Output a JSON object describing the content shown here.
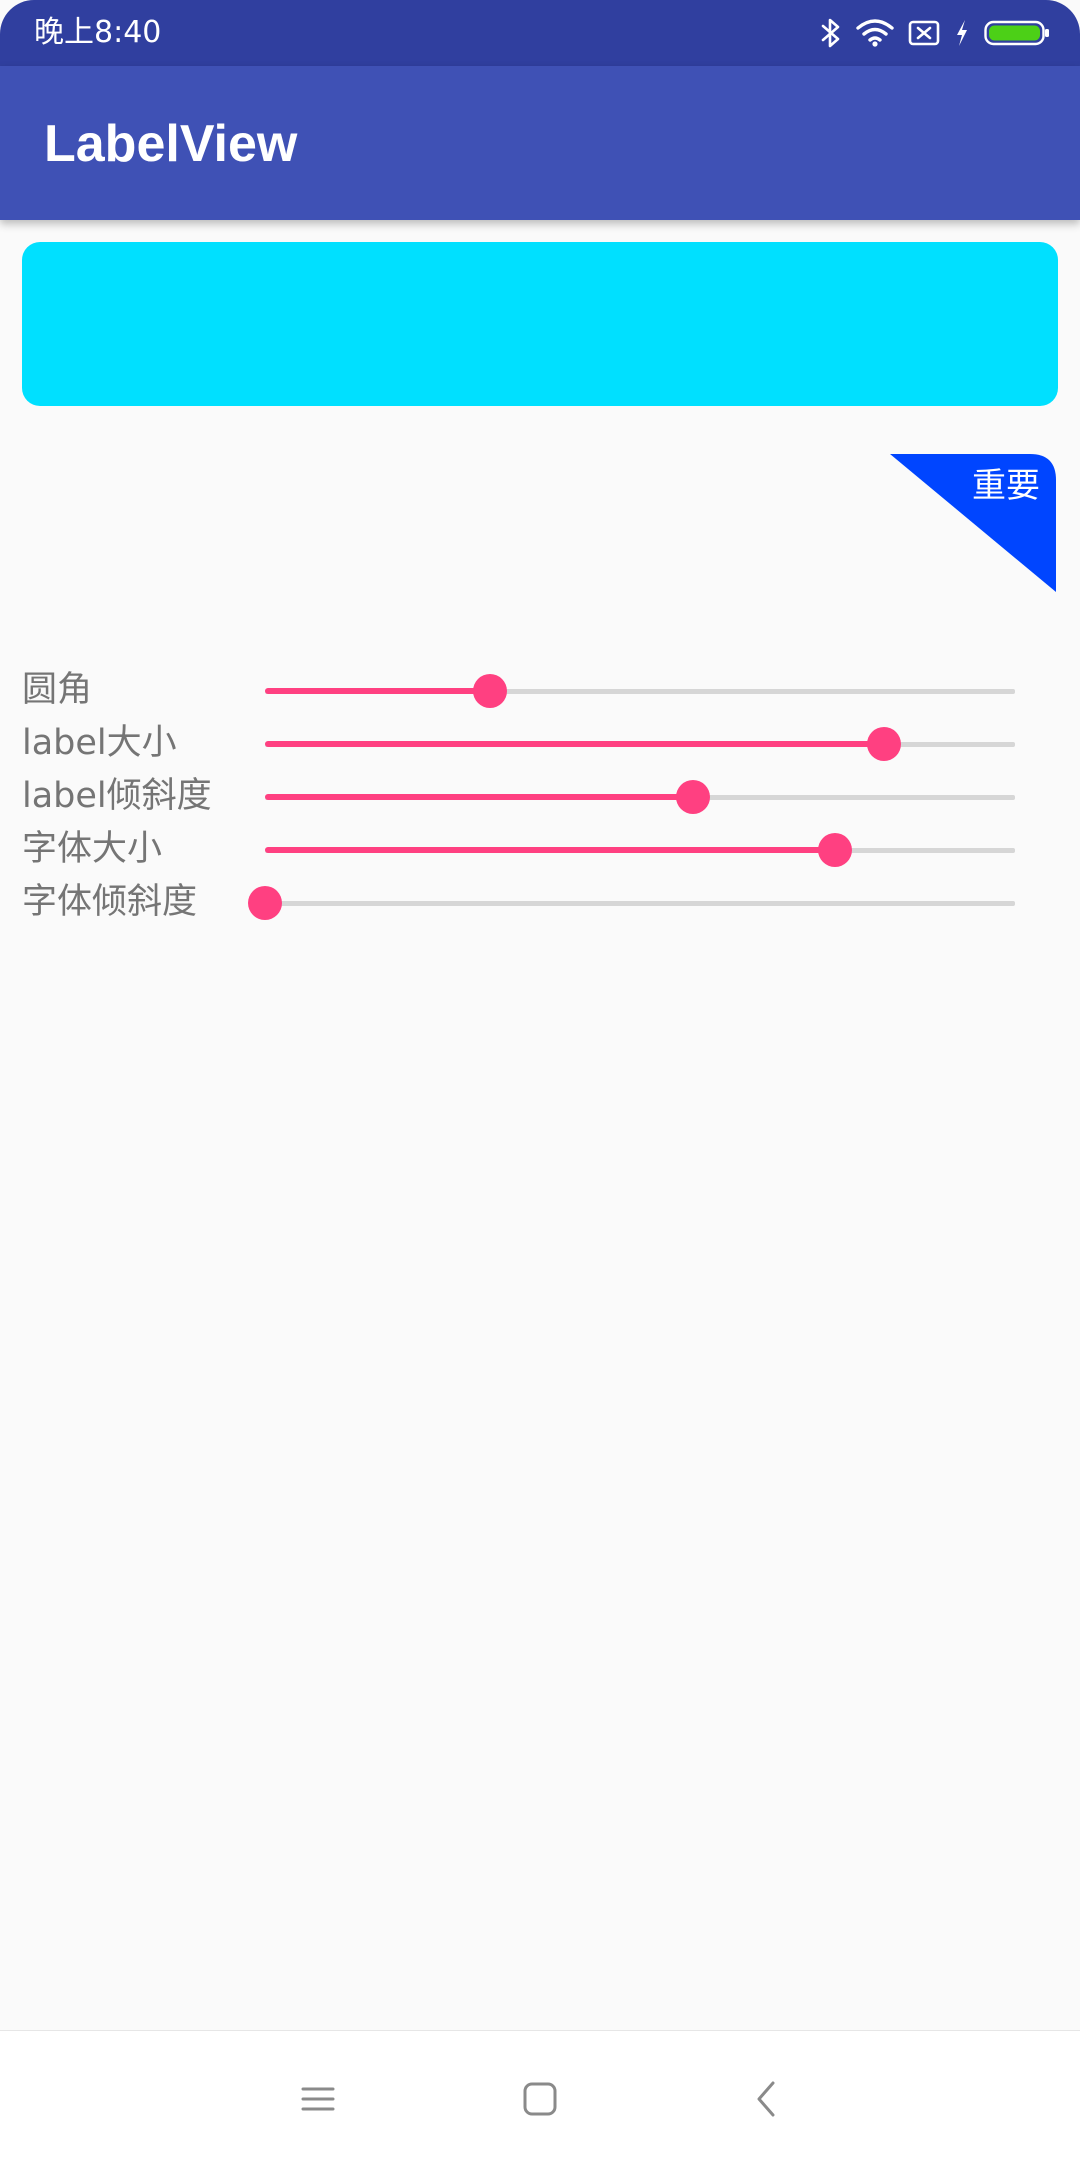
{
  "status_bar": {
    "time": "晚上8:40",
    "icons": [
      "bluetooth-icon",
      "wifi-icon",
      "no-sim-icon",
      "charging-icon",
      "battery-icon"
    ],
    "battery_color": "#4cd017"
  },
  "app_bar": {
    "title": "LabelView",
    "color": "#3f51b5"
  },
  "preview": {
    "color": "#00e0ff"
  },
  "label_demo": {
    "text": "重要",
    "color": "#0045ff"
  },
  "controls": [
    {
      "label": "圆角",
      "progress": 0.3
    },
    {
      "label": "label大小",
      "progress": 0.825
    },
    {
      "label": "label倾斜度",
      "progress": 0.57
    },
    {
      "label": "字体大小",
      "progress": 0.76
    },
    {
      "label": "字体倾斜度",
      "progress": 0.0
    }
  ],
  "accent_color": "#ff4081",
  "nav_bar": {
    "buttons": [
      "menu-icon",
      "home-icon",
      "back-icon"
    ]
  }
}
